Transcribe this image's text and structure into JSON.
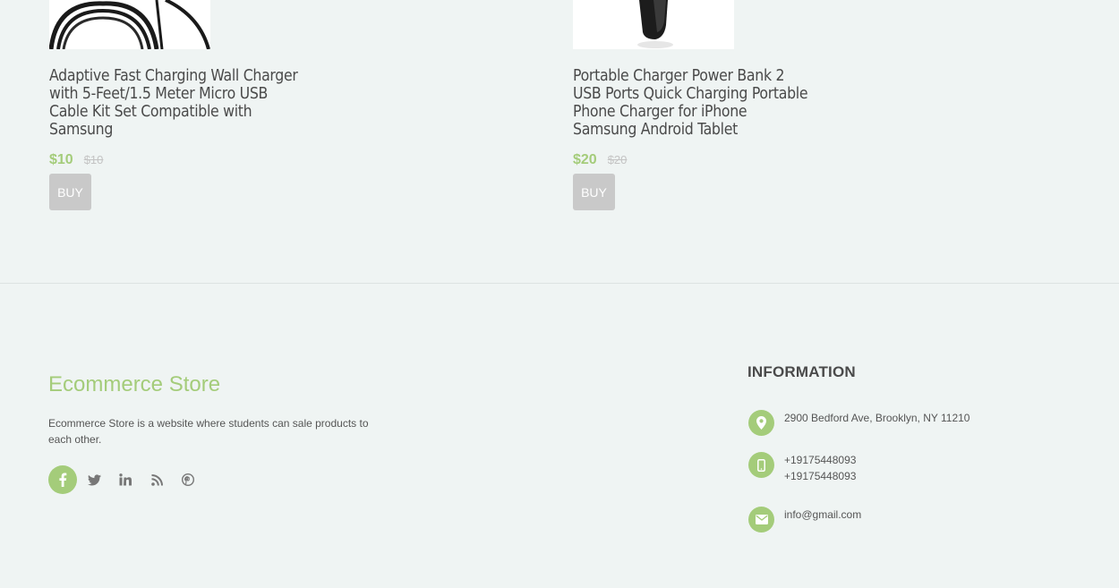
{
  "products": [
    {
      "title": "Adaptive Fast Charging Wall Charger with 5-Feet/1.5 Meter Micro USB Cable Kit Set Compatible with Samsung",
      "price": "$10",
      "old_price": "$10",
      "buy_label": "BUY"
    },
    {
      "title": "Portable Charger Power Bank 2 USB Ports Quick Charging Portable Phone Charger for iPhone Samsung Android Tablet",
      "price": "$20",
      "old_price": "$20",
      "buy_label": "BUY"
    }
  ],
  "footer": {
    "brand": "Ecommerce Store",
    "about": "Ecommerce Store is a website where students can sale products to each other.",
    "socials": [
      "facebook-icon",
      "twitter-icon",
      "linkedin-icon",
      "rss-icon",
      "pinterest-icon"
    ],
    "info_heading": "INFORMATION",
    "address": "2900 Bedford Ave, Brooklyn, NY 11210",
    "phone_1": "+19175448093",
    "phone_2": "+19175448093",
    "email": "info@gmail.com"
  },
  "colors": {
    "accent": "#a4cc7a",
    "background": "#eff4f3",
    "buy_button": "#c9c9c9"
  }
}
